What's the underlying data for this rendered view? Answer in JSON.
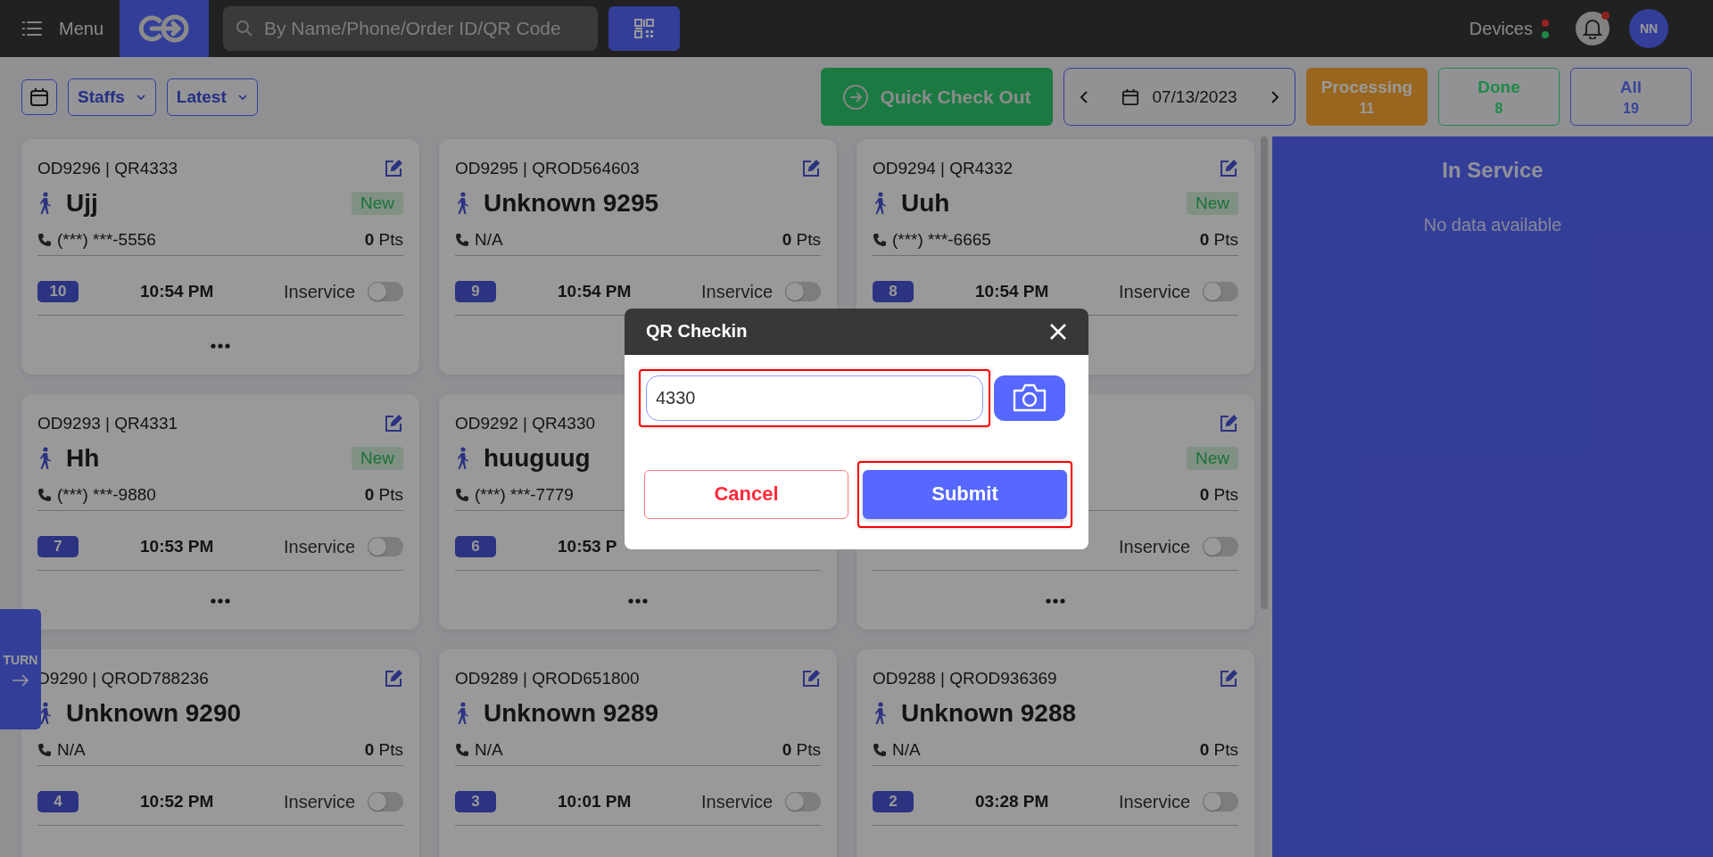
{
  "topbar": {
    "menu_label": "Menu",
    "search": {
      "placeholder": "By Name/Phone/Order ID/QR Code"
    },
    "devices_label": "Devices",
    "device_dots": [
      {
        "color": "#992222"
      },
      {
        "color": "#22884a"
      }
    ],
    "notification_unread": true,
    "avatar": "NN"
  },
  "toolbar": {
    "staffs": "Staffs",
    "sort": "Latest",
    "quick_checkout": "Quick Check Out",
    "date": "07/13/2023",
    "filters": [
      {
        "label": "Processing",
        "count": "11",
        "selected": true,
        "color": "#99661f"
      },
      {
        "label": "Done",
        "count": "8",
        "selected": false,
        "color": "#1f8a48"
      },
      {
        "label": "All",
        "count": "19",
        "selected": false,
        "color": "#3a4599"
      }
    ]
  },
  "cards": [
    {
      "order": "OD9296 | QR4333",
      "name": "Ujj",
      "tag": "New",
      "phone": "(***) ***-5556",
      "pts": "**0** Pts",
      "number": "10",
      "time": "10:54 PM",
      "status_label": "Inservice",
      "inservice": false,
      "edit": true,
      "more": true
    },
    {
      "order": "OD9295 | QROD564603",
      "name": "Unknown 9295",
      "phone": "N/A",
      "pts": "**0** Pts",
      "number": "9",
      "time": "10:54 PM",
      "status_label": "Inservice",
      "inservice": false,
      "edit": true,
      "more": false
    },
    {
      "order": "OD9294 | QR4332",
      "name": "Uuh",
      "tag": "New",
      "phone": "(***) ***-6665",
      "pts": "**0** Pts",
      "number": "8",
      "time": "10:54 PM",
      "status_label": "Inservice",
      "inservice": false,
      "edit": true,
      "more": false
    },
    {
      "order": "OD9293 | QR4331",
      "name": "Hh",
      "tag": "New",
      "phone": "(***) ***-9880",
      "pts": "**0** Pts",
      "number": "7",
      "time": "10:53 PM",
      "status_label": "Inservice",
      "inservice": false,
      "edit": true,
      "more": true
    },
    {
      "order": "OD9292 | QR4330",
      "name": "huuguug",
      "phone": "(***) ***-7779",
      "number": "6",
      "time": "10:53 P",
      "edit": false,
      "more": true
    },
    {
      "tag": "New",
      "pts": "**0** Pts",
      "status_label": "Inservice",
      "inservice": false,
      "edit": true,
      "more": true
    },
    {
      "order": "D9290 | QROD788236",
      "name": "Unknown 9290",
      "phone": "N/A",
      "pts": "**0** Pts",
      "number": "4",
      "time": "10:52 PM",
      "status_label": "Inservice",
      "inservice": false,
      "edit": true,
      "more": false
    },
    {
      "order": "OD9289 | QROD651800",
      "name": "Unknown 9289",
      "phone": "N/A",
      "pts": "**0** Pts",
      "number": "3",
      "time": "10:01 PM",
      "status_label": "Inservice",
      "inservice": false,
      "edit": true,
      "more": false
    },
    {
      "order": "OD9288 | QROD936369",
      "name": "Unknown 9288",
      "phone": "N/A",
      "pts": "**0** Pts",
      "number": "2",
      "time": "03:28 PM",
      "status_label": "Inservice",
      "inservice": false,
      "edit": true,
      "more": false
    }
  ],
  "in_service": {
    "title": "In Service",
    "empty_text": "No data available"
  },
  "turn_tab": {
    "label": "TURN"
  },
  "modal": {
    "title": "QR Checkin",
    "field": {
      "value": "4330",
      "highlighted": true
    },
    "cancel": {
      "label": "Cancel",
      "highlighted": false
    },
    "submit": {
      "label": "Submit",
      "highlighted": true
    }
  }
}
